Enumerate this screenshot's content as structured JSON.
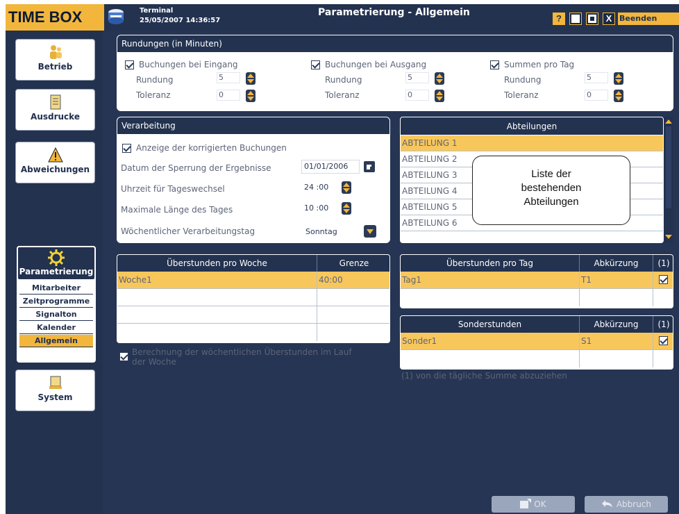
{
  "app": {
    "logo": "TIME BOX",
    "terminal_label": "Terminal",
    "datetime": "25/05/2007 14:36:57",
    "window_title": "Parametrierung - Allgemein",
    "help_label": "?",
    "close_label": "X",
    "exit_label": "Beenden"
  },
  "sidebar": {
    "betrieb": "Betrieb",
    "ausdrucke": "Ausdrucke",
    "abweichungen": "Abweichungen",
    "parametrierung": "Parametrierung",
    "sub_items": [
      "Mitarbeiter",
      "Zeitprogramme",
      "Signalton",
      "Kalender",
      "Allgemein"
    ],
    "active_sub": "Allgemein",
    "system": "System"
  },
  "rundungen": {
    "title": "Rundungen (in Minuten)",
    "groups": [
      {
        "check": "Buchungen bei Eingang",
        "rundung_label": "Rundung",
        "rundung": "5",
        "toleranz_label": "Toleranz",
        "toleranz": "0"
      },
      {
        "check": "Buchungen bei Ausgang",
        "rundung_label": "Rundung",
        "rundung": "5",
        "toleranz_label": "Toleranz",
        "toleranz": "0"
      },
      {
        "check": "Summen pro Tag",
        "rundung_label": "Rundung",
        "rundung": "5",
        "toleranz_label": "Toleranz",
        "toleranz": "0"
      }
    ]
  },
  "verarbeitung": {
    "title": "Verarbeitung",
    "check_label": "Anzeige der korrigierten Buchungen",
    "sperrung_label": "Datum der Sperrung der Ergebnisse",
    "sperrung_value": "01/01/2006",
    "tageswechsel_label": "Uhrzeit für Tageswechsel",
    "tageswechsel_value": "24 :00",
    "laenge_label": "Maximale Länge des Tages",
    "laenge_value": "10 :00",
    "tag_label": "Wöchentlicher Verarbeitungstag",
    "tag_value": "Sonntag"
  },
  "abteilungen": {
    "title": "Abteilungen",
    "items": [
      "ABTEILUNG 1",
      "ABTEILUNG 2",
      "ABTEILUNG 3",
      "ABTEILUNG 4",
      "ABTEILUNG 5",
      "ABTEILUNG 6"
    ],
    "callout": [
      "Liste der",
      "bestehenden",
      "Abteilungen"
    ]
  },
  "woche": {
    "col1": "Überstunden pro Woche",
    "col2": "Grenze",
    "rows": [
      [
        "Woche1",
        "40:00"
      ]
    ],
    "bottom_check": "Berechnung der wöchentlichen Überstunden im Lauf",
    "bottom_check2": "der Woche"
  },
  "tag": {
    "col1": "Überstunden pro Tag",
    "col2": "Abkürzung",
    "col3": "(1)",
    "rows": [
      [
        "Tag1",
        "T1"
      ]
    ]
  },
  "sonder": {
    "col1": "Sonderstunden",
    "col2": "Abkürzung",
    "col3": "(1)",
    "rows": [
      [
        "Sonder1",
        "S1"
      ]
    ],
    "footnote": "(1) von die tägliche Summe abzuziehen"
  },
  "footer": {
    "ok": "OK",
    "abbruch": "Abbruch"
  },
  "colors": {
    "accent": "#f2b63c",
    "navy": "#23324f",
    "selection": "#f8c75c"
  }
}
